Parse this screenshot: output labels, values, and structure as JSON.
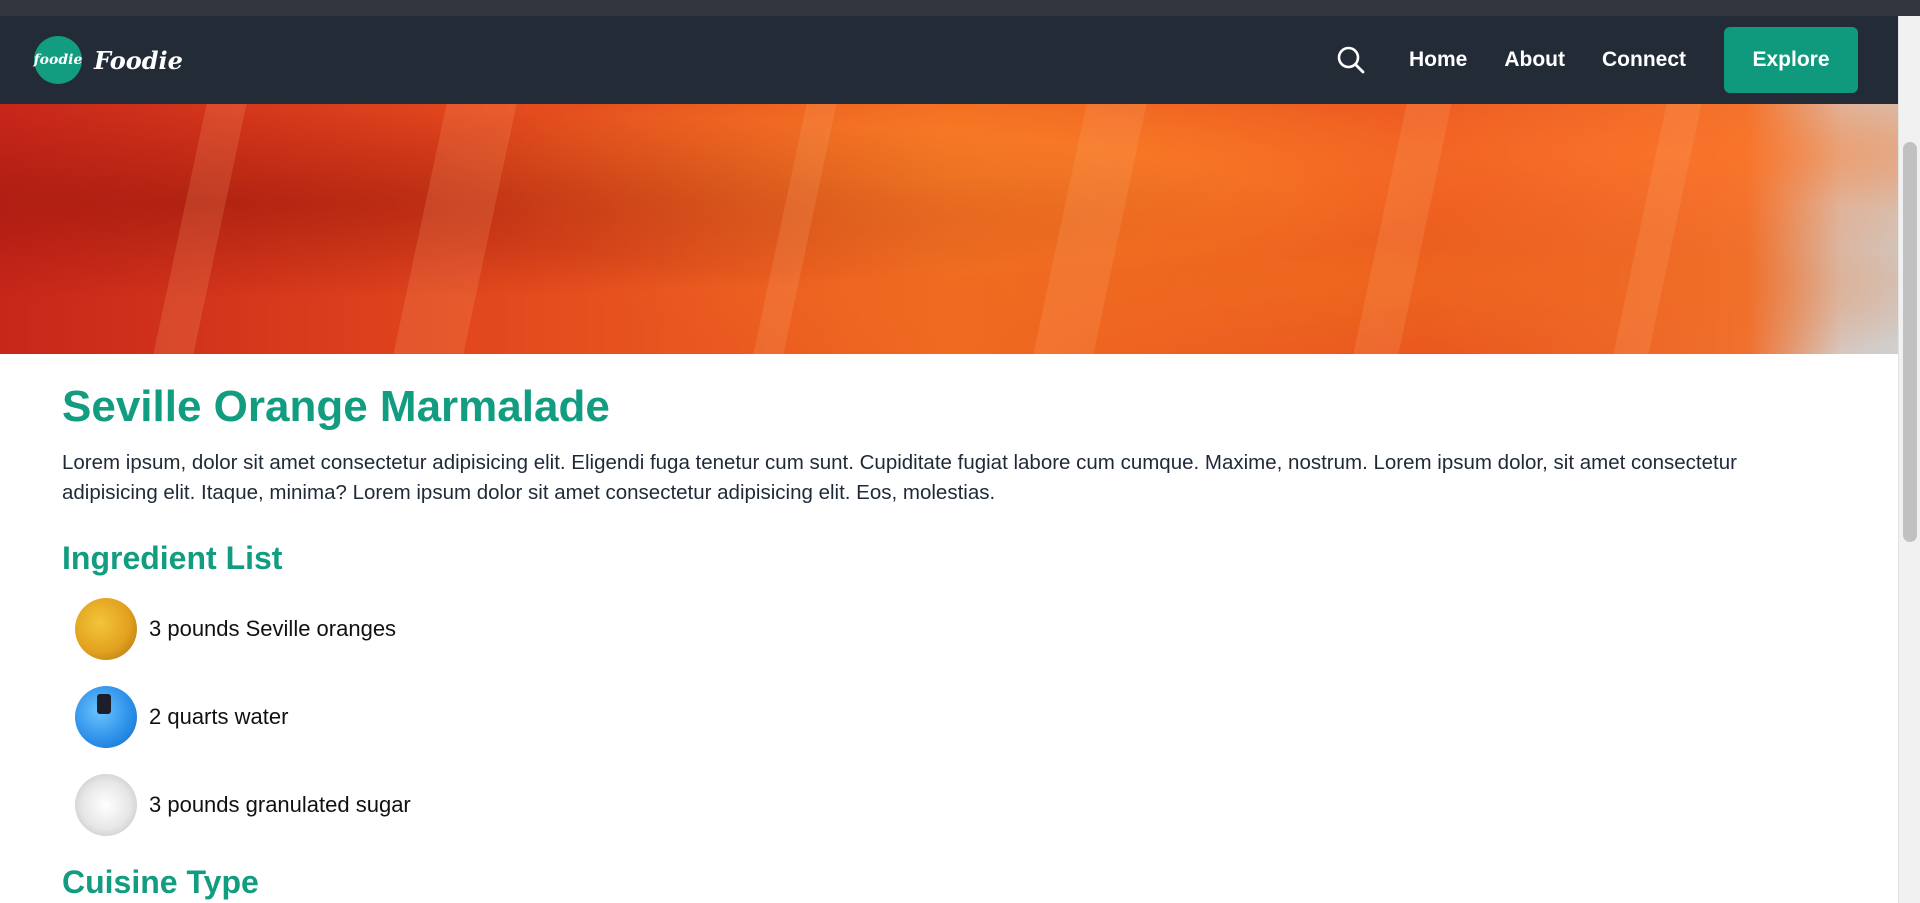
{
  "brand": {
    "logo_text": "foodie",
    "name": "Foodie"
  },
  "nav": {
    "search_icon": "search-icon",
    "links": [
      "Home",
      "About",
      "Connect"
    ],
    "cta": "Explore"
  },
  "colors": {
    "accent": "#129c80",
    "navbar": "#232b37",
    "button": "#0f9a7d"
  },
  "recipe": {
    "title": "Seville Orange Marmalade",
    "intro": "Lorem ipsum, dolor sit amet consectetur adipisicing elit. Eligendi fuga tenetur cum sunt. Cupiditate fugiat labore cum cumque. Maxime, nostrum. Lorem ipsum dolor, sit amet consectetur adipisicing elit. Itaque, minima? Lorem ipsum dolor sit amet consectetur adipisicing elit. Eos, molestias.",
    "ingredients_heading": "Ingredient List",
    "ingredients": [
      {
        "label": "3 pounds Seville oranges",
        "icon": "orange-image"
      },
      {
        "label": "2 quarts water",
        "icon": "water-image"
      },
      {
        "label": "3 pounds granulated sugar",
        "icon": "sugar-image"
      }
    ],
    "cuisine_heading": "Cuisine Type"
  }
}
